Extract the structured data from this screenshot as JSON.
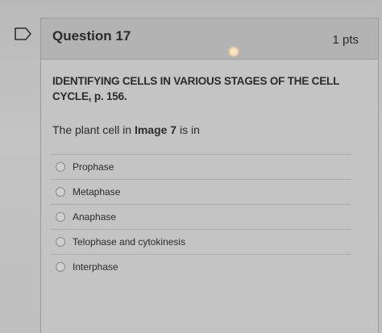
{
  "question": {
    "title": "Question 17",
    "points": "1 pts",
    "heading": "IDENTIFYING CELLS IN VARIOUS STAGES OF THE CELL CYCLE, p. 156.",
    "prompt_prefix": "The plant cell in ",
    "prompt_bold": "Image 7",
    "prompt_suffix": " is in"
  },
  "answers": [
    {
      "label": "Prophase"
    },
    {
      "label": "Metaphase"
    },
    {
      "label": "Anaphase"
    },
    {
      "label": "Telophase and cytokinesis"
    },
    {
      "label": "Interphase"
    }
  ],
  "colors": {
    "background": "#bcbcbc",
    "header": "#b3b3b3",
    "text": "#2b2b2b"
  }
}
